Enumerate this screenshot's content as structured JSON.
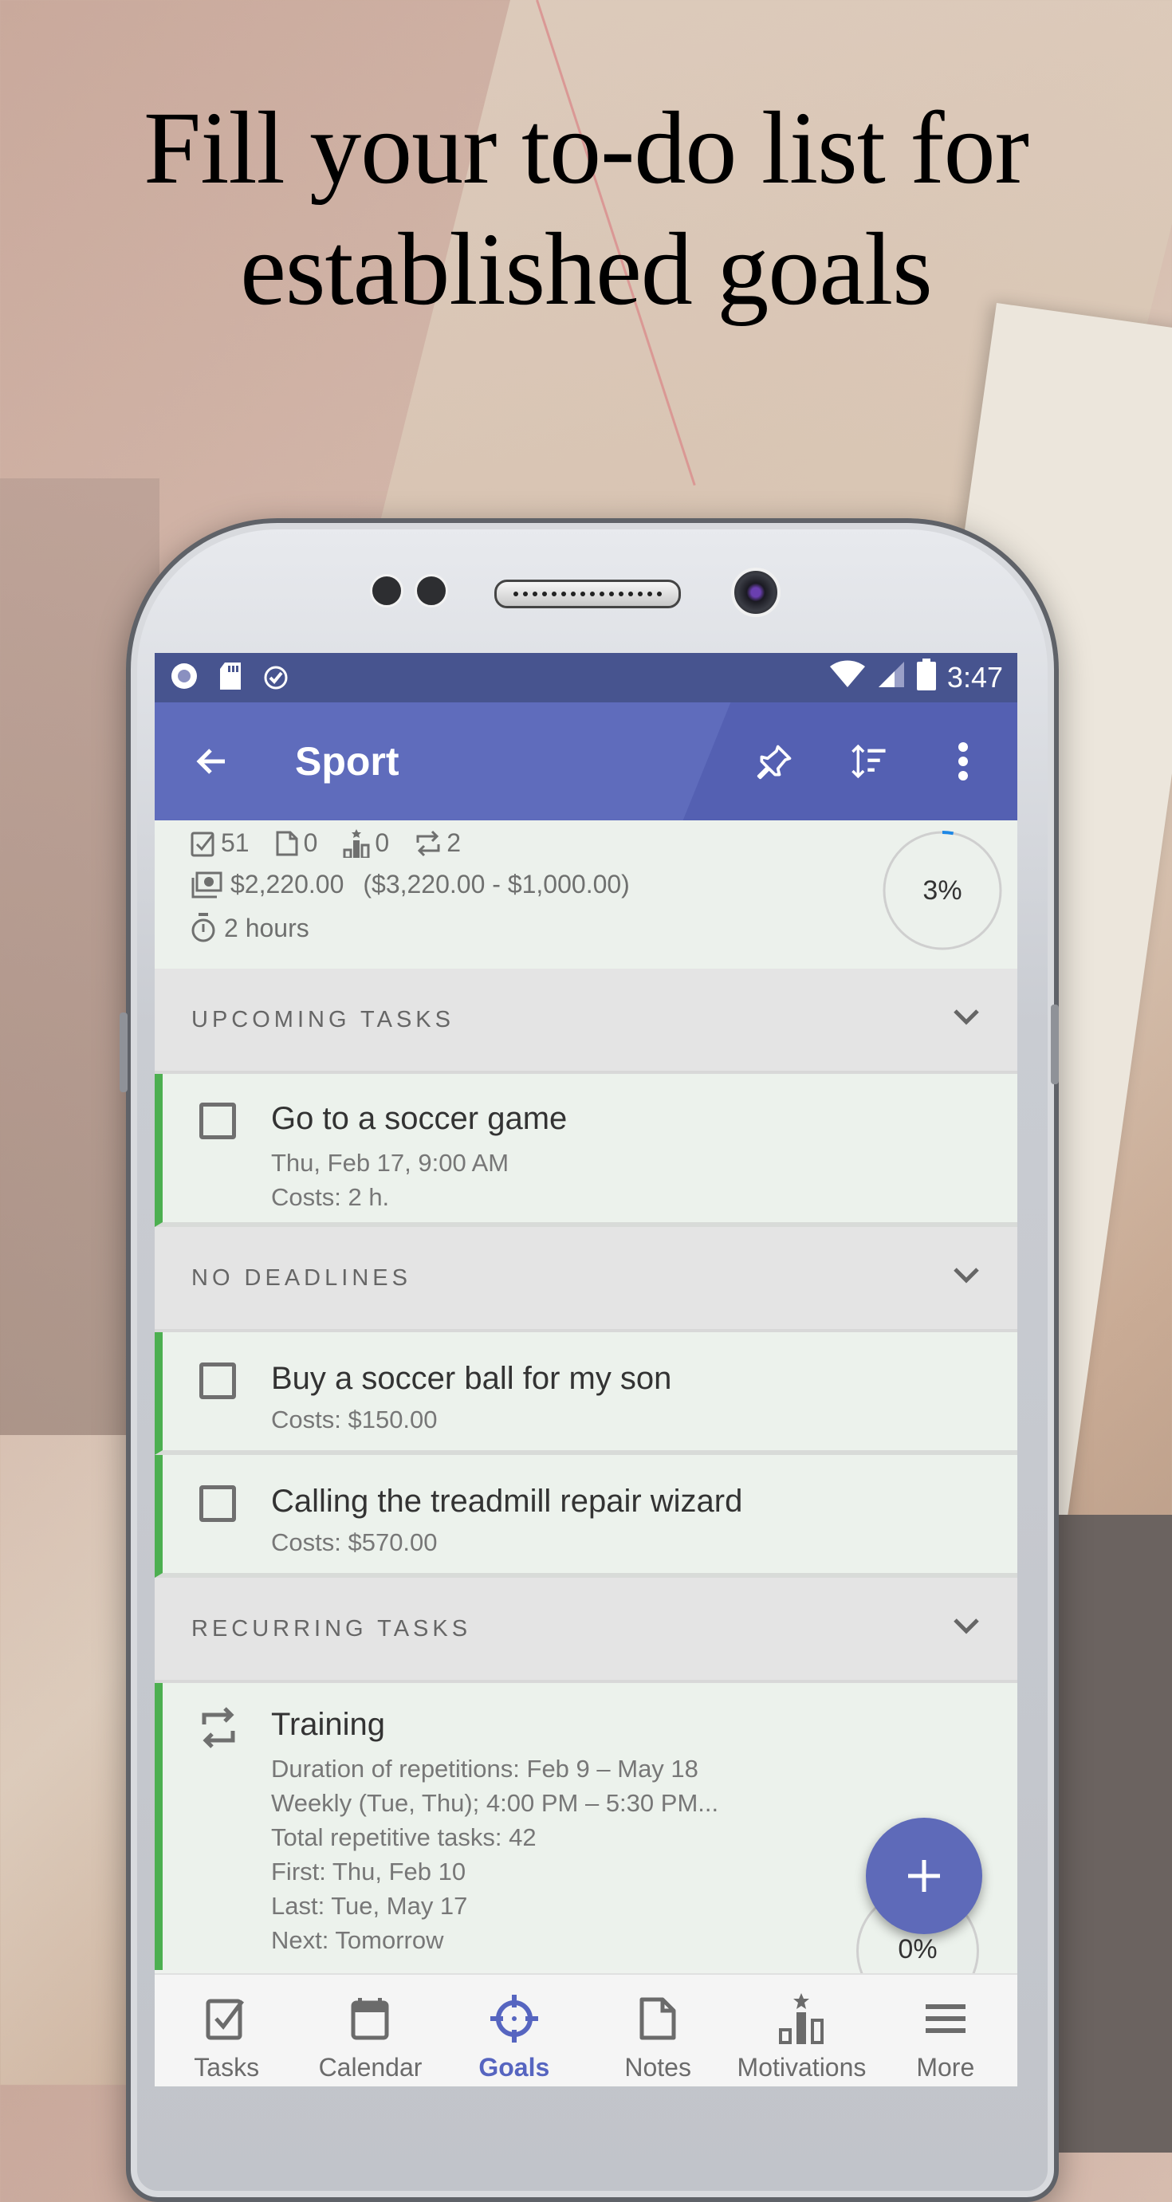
{
  "headline": {
    "line1": "Fill your to-do list for",
    "line2": "established goals"
  },
  "status_bar": {
    "time": "3:47",
    "left_icons": [
      "record-icon",
      "sd-card-icon",
      "alarm-check-icon"
    ],
    "right_icons": [
      "wifi-icon",
      "signal-icon",
      "battery-icon"
    ]
  },
  "app_bar": {
    "title": "Sport",
    "back_icon": "arrow-left-icon",
    "actions": [
      "pin-icon",
      "sort-icon",
      "more-vert-icon"
    ]
  },
  "summary": {
    "tasks_count": "51",
    "notes_count": "0",
    "motivations_count": "0",
    "recurring_count": "2",
    "money": "$2,220.00",
    "money_breakdown": "($3,220.00 - $1,000.00)",
    "time": "2 hours",
    "progress_label": "3%",
    "progress_value": 0.03
  },
  "sections": [
    {
      "title": "UPCOMING TASKS",
      "tasks": [
        {
          "title": "Go to a soccer game",
          "lines": [
            "Thu, Feb 17, 9:00 AM",
            "Costs: 2 h."
          ]
        }
      ]
    },
    {
      "title": "NO DEADLINES",
      "tasks": [
        {
          "title": "Buy a soccer ball for my son",
          "lines": [
            "Costs: $150.00"
          ]
        },
        {
          "title": "Calling the treadmill repair wizard",
          "lines": [
            "Costs: $570.00"
          ]
        }
      ]
    },
    {
      "title": "RECURRING TASKS",
      "tasks": [
        {
          "title": "Training",
          "lines": [
            "Duration of repetitions: Feb 9 – May 18",
            "Weekly (Tue, Thu); 4:00 PM – 5:30 PM...",
            "Total repetitive tasks: 42",
            "First: Thu, Feb 10",
            "Last: Tue, May 17",
            "Next: Tomorrow"
          ],
          "progress_label": "0%",
          "progress_value": 0
        }
      ]
    }
  ],
  "fab": {
    "icon": "plus-icon"
  },
  "bottom_nav": [
    {
      "label": "Tasks",
      "icon": "checkbox-icon",
      "active": false
    },
    {
      "label": "Calendar",
      "icon": "calendar-icon",
      "active": false
    },
    {
      "label": "Goals",
      "icon": "target-icon",
      "active": true
    },
    {
      "label": "Notes",
      "icon": "note-icon",
      "active": false
    },
    {
      "label": "Motivations",
      "icon": "podium-icon",
      "active": false
    },
    {
      "label": "More",
      "icon": "menu-icon",
      "active": false
    }
  ],
  "colors": {
    "primary": "#5f6cbc",
    "status_bar": "#47548f",
    "accent_green": "#4caf50",
    "active_nav": "#5665c0",
    "progress_blue": "#1e88e5"
  }
}
